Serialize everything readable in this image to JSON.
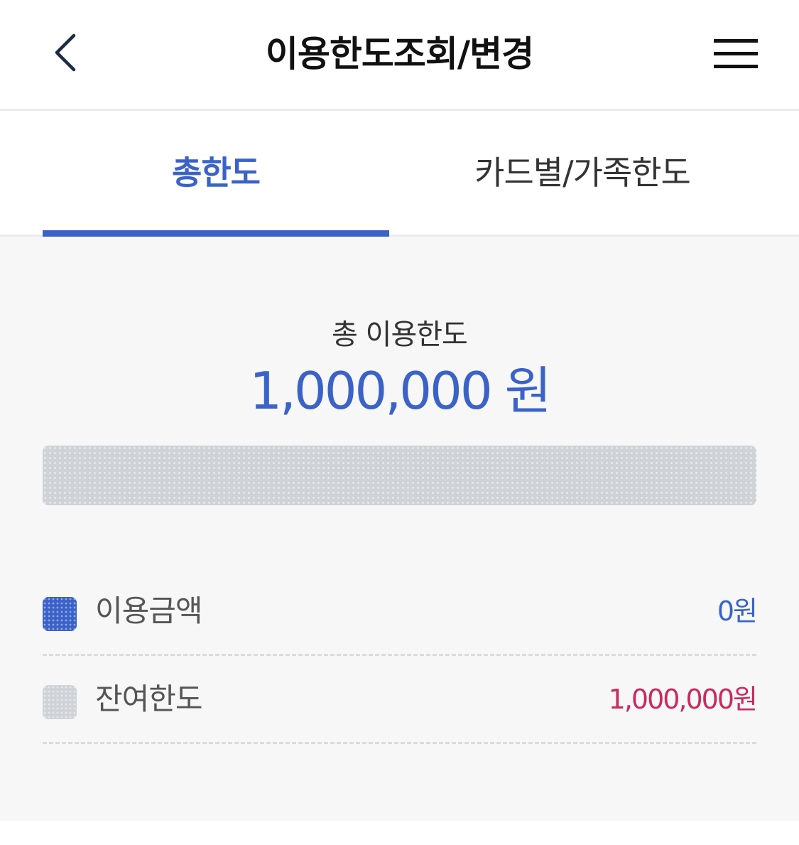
{
  "header": {
    "title": "이용한도조회/변경",
    "back_icon": "chevron-left-icon",
    "menu_icon": "hamburger-menu-icon"
  },
  "tabs": [
    {
      "label": "총한도",
      "active": true
    },
    {
      "label": "카드별/가족한도",
      "active": false
    }
  ],
  "summary": {
    "label": "총 이용한도",
    "amount": "1,000,000 원"
  },
  "usage": {
    "used_fraction": 0,
    "legend": [
      {
        "label": "이용금액",
        "value": "0원",
        "color": "#3a62c9"
      },
      {
        "label": "잔여한도",
        "value": "1,000,000원",
        "color": "#c92a5f"
      }
    ]
  },
  "colors": {
    "accent": "#3a62c9",
    "remaining_value": "#c92a5f",
    "bar_remaining": "#cfd3d8",
    "background": "#f7f7f7"
  }
}
